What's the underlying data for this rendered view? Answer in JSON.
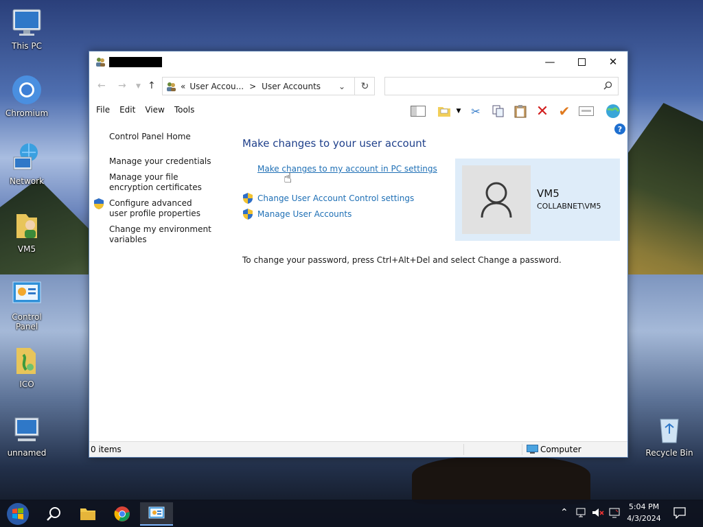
{
  "desktop": {
    "icons": [
      {
        "label": "This PC"
      },
      {
        "label": "Chromium"
      },
      {
        "label": "Network"
      },
      {
        "label": "VM5"
      },
      {
        "label": "Control Panel"
      },
      {
        "label": "ICO"
      },
      {
        "label": "unnamed"
      },
      {
        "label": "Recycle Bin"
      }
    ]
  },
  "window": {
    "address": {
      "prefix": "«",
      "crumb1": "User Accou...",
      "sep": ">",
      "crumb2": "User Accounts"
    },
    "search": {
      "placeholder": ""
    },
    "menu": [
      "File",
      "Edit",
      "View",
      "Tools"
    ],
    "left": {
      "home": "Control Panel Home",
      "links": [
        "Manage your credentials",
        "Manage your file encryption certificates",
        "Configure advanced user profile properties",
        "Change my environment variables"
      ]
    },
    "main": {
      "heading": "Make changes to your user account",
      "pc_settings_link": "Make changes to my account in PC settings",
      "uac_link": "Change User Account Control settings",
      "manage_link": "Manage User Accounts",
      "password_note": "To change your password, press Ctrl+Alt+Del and select Change a password."
    },
    "user": {
      "name": "VM5",
      "domain": "COLLABNET\\VM5"
    },
    "status": {
      "items": "0 items",
      "zone": "Computer"
    }
  },
  "taskbar": {
    "time": "5:04 PM",
    "date": "4/3/2024"
  },
  "colors": {
    "link": "#1e6fb5",
    "heading": "#1e3f8a",
    "panel": "#deecf9"
  }
}
